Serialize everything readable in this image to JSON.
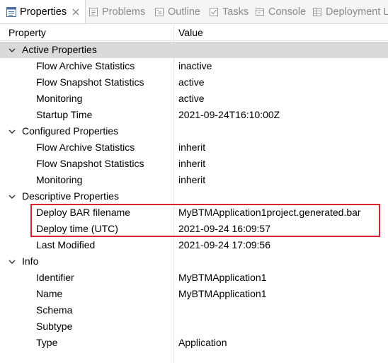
{
  "tabs": [
    {
      "label": "Properties",
      "icon": "properties-icon",
      "active": true
    },
    {
      "label": "Problems",
      "icon": "problems-icon",
      "active": false
    },
    {
      "label": "Outline",
      "icon": "outline-icon",
      "active": false
    },
    {
      "label": "Tasks",
      "icon": "tasks-icon",
      "active": false
    },
    {
      "label": "Console",
      "icon": "console-icon",
      "active": false
    },
    {
      "label": "Deployment L",
      "icon": "deployment-log-icon",
      "active": false
    }
  ],
  "columns": {
    "property": "Property",
    "value": "Value"
  },
  "groups": {
    "active": {
      "label": "Active Properties",
      "rows": [
        {
          "property": "Flow Archive Statistics",
          "value": "inactive"
        },
        {
          "property": "Flow Snapshot Statistics",
          "value": "active"
        },
        {
          "property": "Monitoring",
          "value": "active"
        },
        {
          "property": "Startup Time",
          "value": "2021-09-24T16:10:00Z"
        }
      ]
    },
    "configured": {
      "label": "Configured Properties",
      "rows": [
        {
          "property": "Flow Archive Statistics",
          "value": "inherit"
        },
        {
          "property": "Flow Snapshot Statistics",
          "value": "inherit"
        },
        {
          "property": "Monitoring",
          "value": "inherit"
        }
      ]
    },
    "descriptive": {
      "label": "Descriptive Properties",
      "rows": [
        {
          "property": "Deploy BAR filename",
          "value": "MyBTMApplication1project.generated.bar"
        },
        {
          "property": "Deploy time (UTC)",
          "value": "2021-09-24 16:09:57"
        },
        {
          "property": "Last Modified",
          "value": "2021-09-24 17:09:56"
        }
      ]
    },
    "info": {
      "label": "Info",
      "rows": [
        {
          "property": "Identifier",
          "value": "MyBTMApplication1"
        },
        {
          "property": "Name",
          "value": "MyBTMApplication1"
        },
        {
          "property": "Schema",
          "value": ""
        },
        {
          "property": "Subtype",
          "value": ""
        },
        {
          "property": "Type",
          "value": "Application"
        }
      ]
    }
  },
  "colors": {
    "selected_row": "#dadada",
    "highlight_border": "#d9232e",
    "tab_inactive_text": "#8a8a8a"
  }
}
